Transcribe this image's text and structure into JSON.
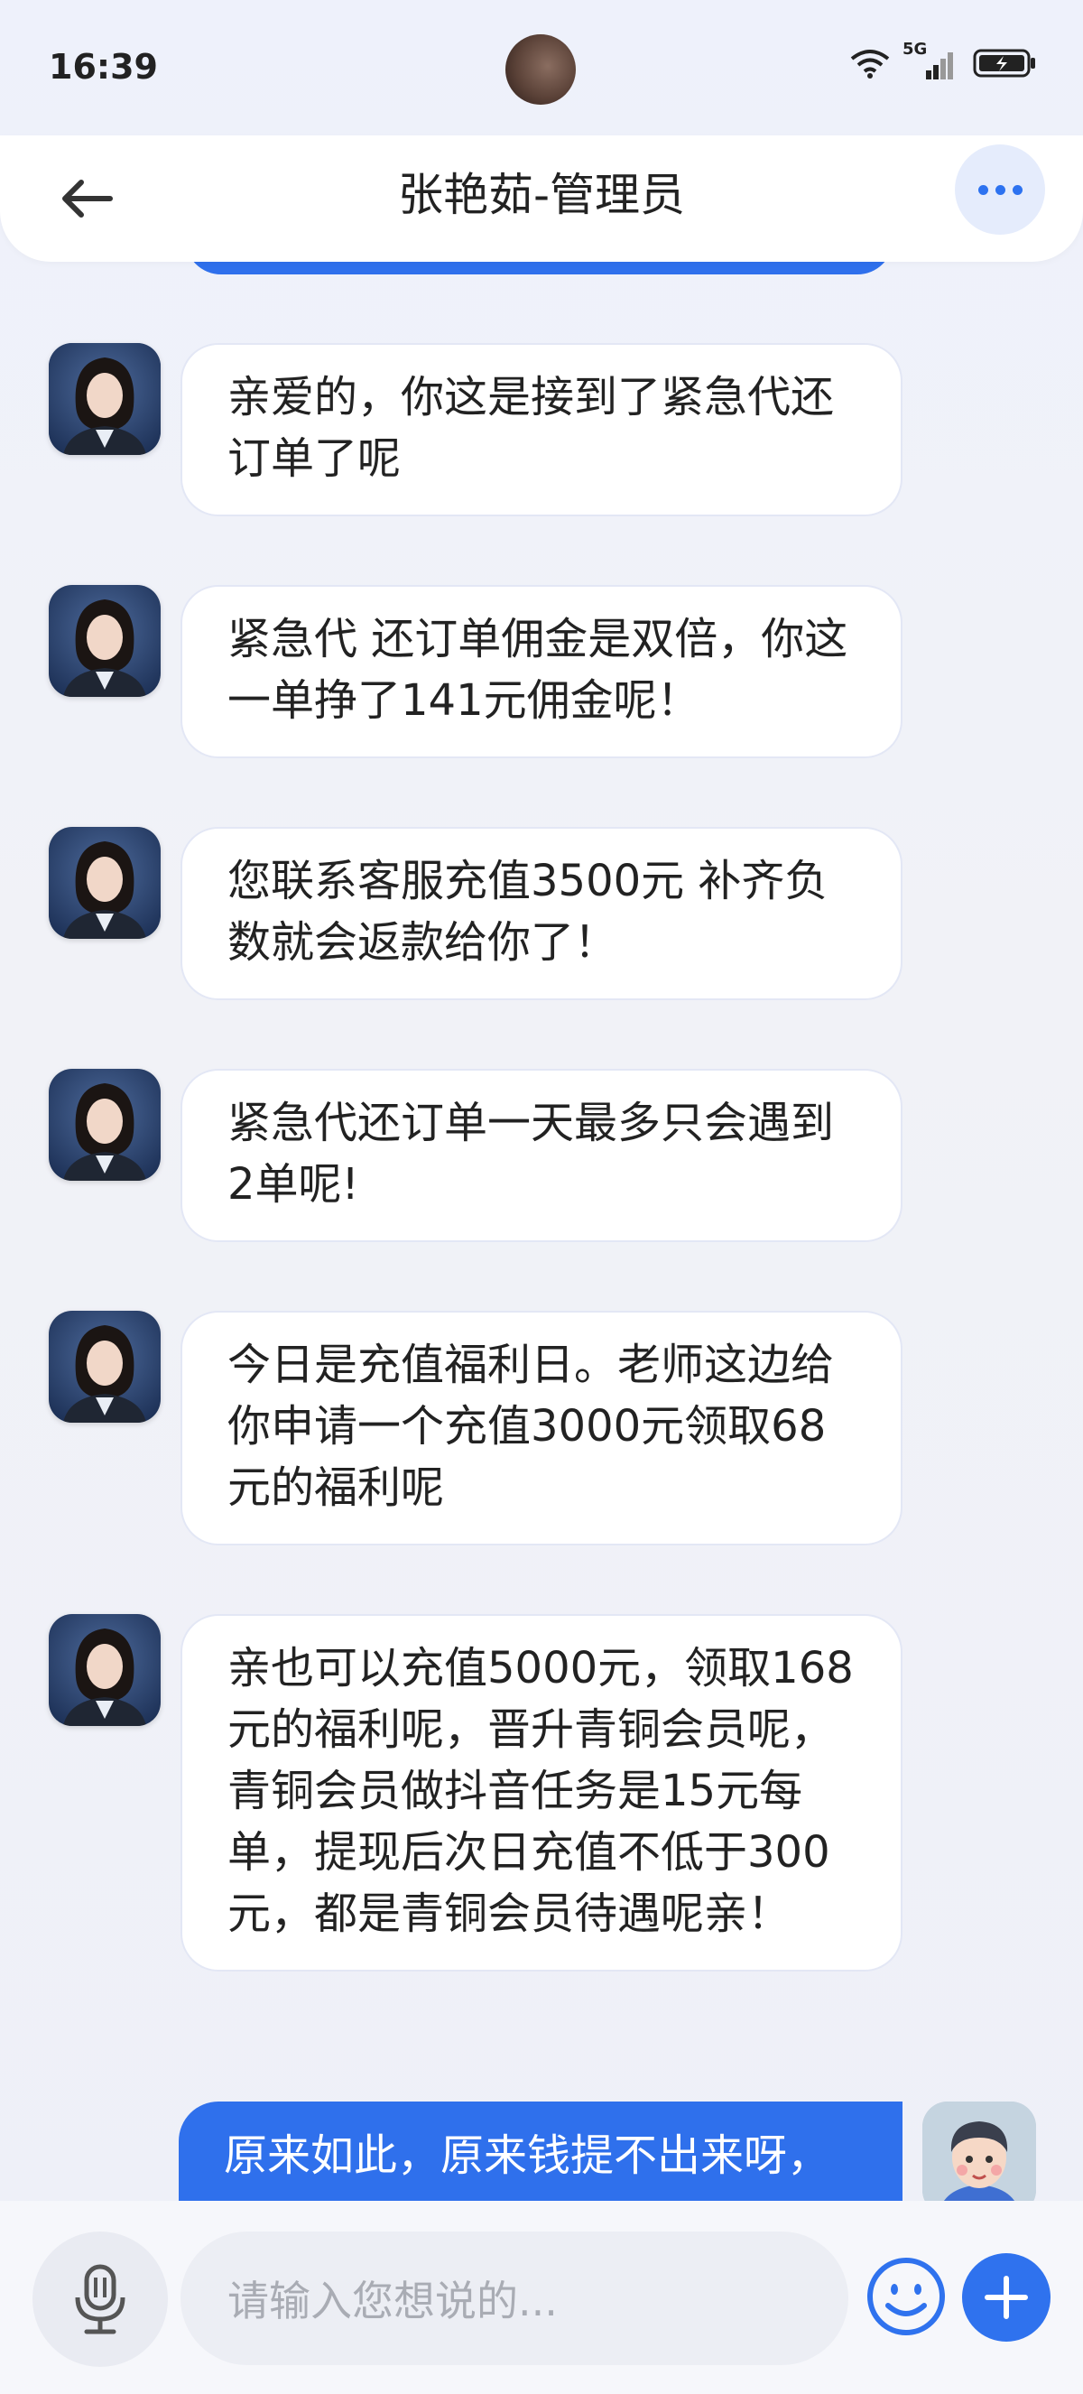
{
  "status_bar": {
    "time": "16:39",
    "network": "5G"
  },
  "header": {
    "title": "张艳茹-管理员"
  },
  "messages": [
    {
      "text": "亲爱的，你这是接到了紧急代还订单了呢"
    },
    {
      "text": "紧急代 还订单佣金是双倍，你这一单挣了141元佣金呢！"
    },
    {
      "text": "您联系客服充值3500元  补齐负数就会返款给你了！"
    },
    {
      "text": "紧急代还订单一天最多只会遇到2单呢!"
    },
    {
      "text": "今日是充值福利日。老师这边给你申请一个充值3000元领取68元的福利呢"
    },
    {
      "text": "亲也可以充值5000元，领取168元的福利呢，晋升青铜会员呢，青铜会员做抖音任务是15元每单，提现后次日充值不低于300元，都是青铜会员待遇呢亲！"
    }
  ],
  "sent": {
    "text": "原来如此，原来钱提不出来呀，"
  },
  "input": {
    "placeholder": "请输入您想说的..."
  },
  "colors": {
    "accent": "#2f70ec",
    "bubble_border": "#e3e7f5"
  }
}
